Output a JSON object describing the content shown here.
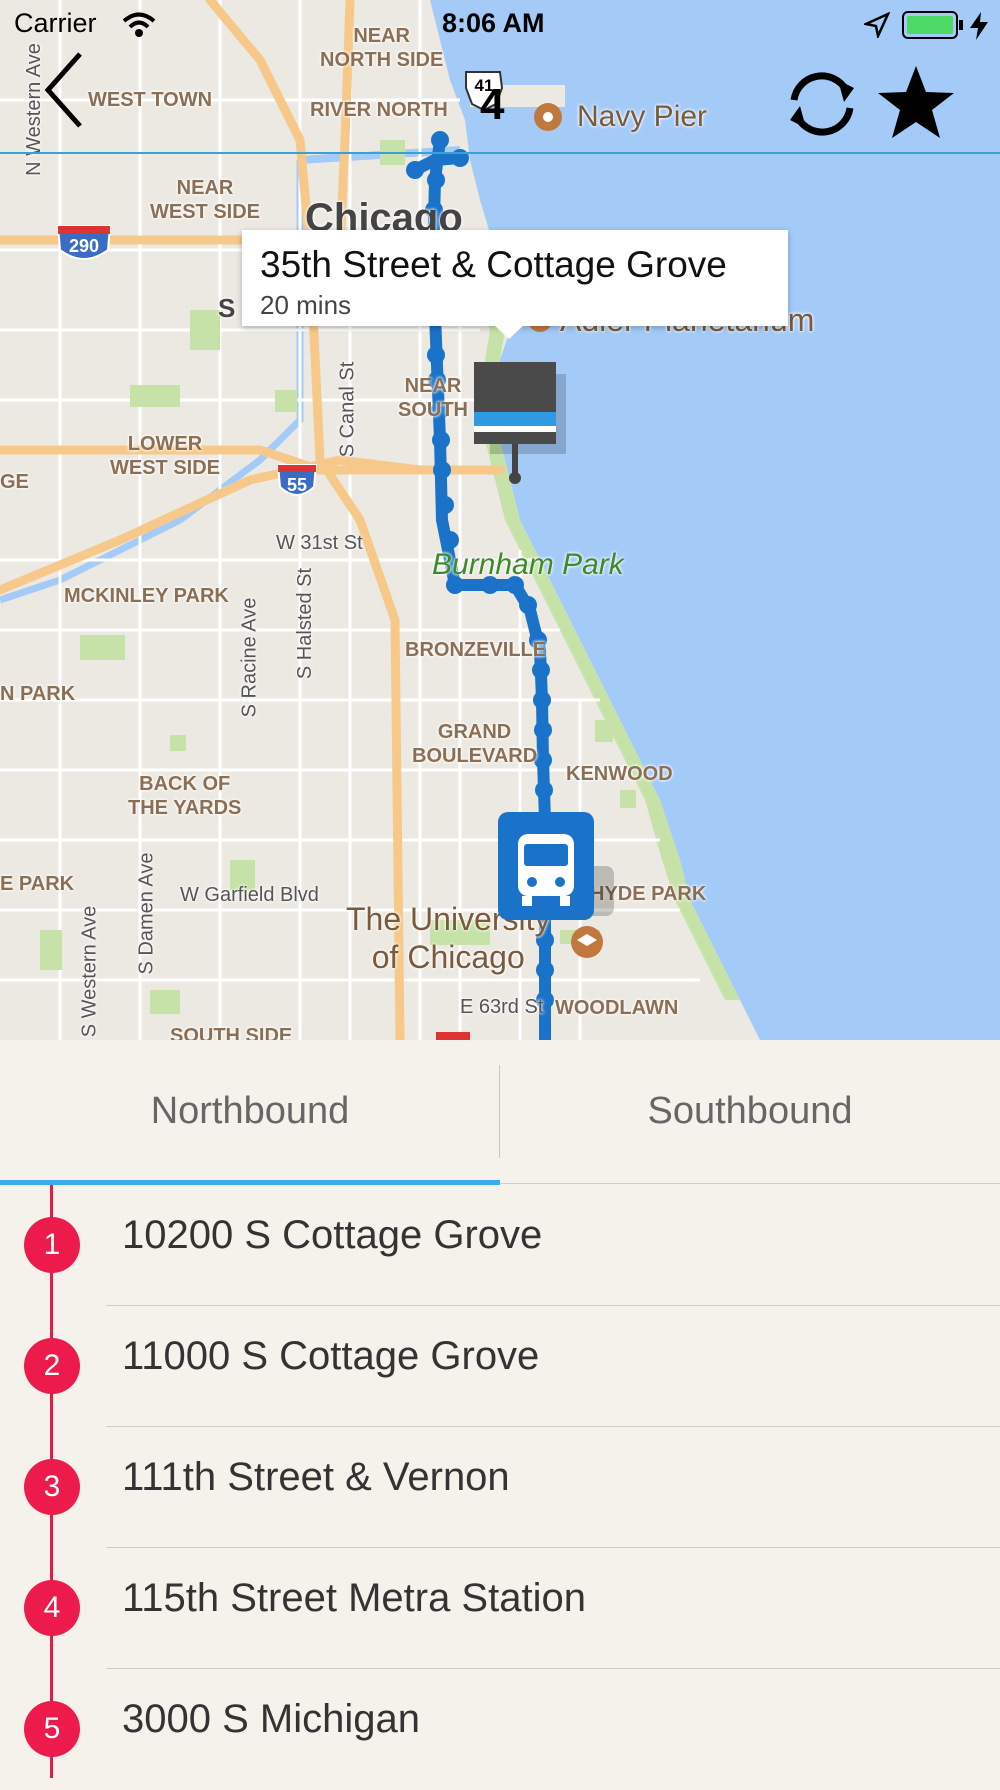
{
  "status_bar": {
    "carrier": "Carrier",
    "time": "8:06 AM"
  },
  "nav": {
    "route_number": "4",
    "route_shield": "41",
    "back_icon": "chevron-left-icon",
    "refresh_icon": "refresh-icon",
    "favorite_icon": "star-icon"
  },
  "map": {
    "labels": {
      "near_north_side": "NEAR\nNORTH SIDE",
      "west_town": "WEST TOWN",
      "river_north": "RIVER NORTH",
      "navy_pier": "Navy Pier",
      "near_west_side": "NEAR\nWEST SIDE",
      "chicago": "Chicago",
      "lower_west_side": "LOWER\nWEST SIDE",
      "mckinley_park": "MCKINLEY PARK",
      "bronzeville": "BRONZEVILLE",
      "grand_boulevard": "GRAND\nBOULEVARD",
      "kenwood": "KENWOOD",
      "back_of_the_yards": "BACK OF\nTHE YARDS",
      "hyde_park": "HYDE PARK",
      "university": "The University\nof Chicago",
      "woodlawn": "WOODLAWN",
      "south_side": "SOUTH SIDE",
      "burnham_park": "Burnham Park",
      "adler": "Adler Planetarium",
      "near_south": "NEAR\nSOUTH",
      "ge": "GE",
      "n_park": "N PARK",
      "e_park": "E PARK",
      "s_partial": "S"
    },
    "streets": {
      "w_31st": "W 31st St",
      "w_garfield": "W Garfield Blvd",
      "e_63rd": "E 63rd St",
      "s_canal": "S Canal St",
      "s_halsted": "S Halsted St",
      "s_racine": "S Racine Ave",
      "s_damen": "S Damen Ave",
      "s_western": "S Western Ave",
      "n_western": "N Western Ave"
    },
    "shields": {
      "i290": "290",
      "i55": "55"
    },
    "colors": {
      "route": "#1a73c8",
      "water": "#a4cbf8",
      "land": "#ece9e3",
      "park": "#c6e2a8",
      "highway": "#f6c98a"
    }
  },
  "callout": {
    "title": "35th Street & Cottage Grove",
    "subtitle": "20 mins"
  },
  "tabs": {
    "northbound": "Northbound",
    "southbound": "Southbound",
    "selected": "Northbound"
  },
  "stops": [
    {
      "number": "1",
      "name": "10200 S Cottage Grove"
    },
    {
      "number": "2",
      "name": "11000 S Cottage Grove"
    },
    {
      "number": "3",
      "name": "111th Street & Vernon"
    },
    {
      "number": "4",
      "name": "115th Street Metra Station"
    },
    {
      "number": "5",
      "name": "3000 S Michigan"
    }
  ]
}
